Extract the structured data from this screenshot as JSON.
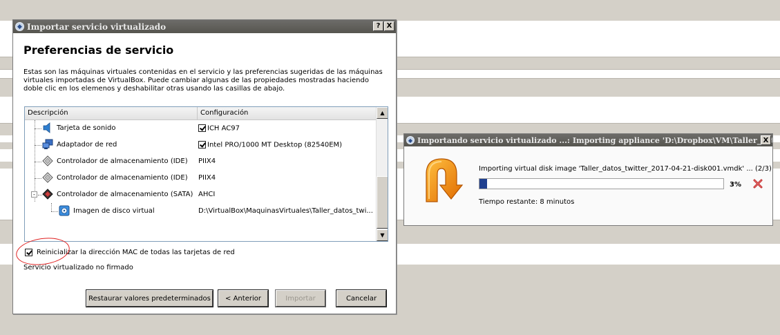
{
  "main_dialog": {
    "title": "Importar servicio virtualizado",
    "help_button": "?",
    "close_button": "X",
    "heading": "Preferencias de servicio",
    "description": "Estas son las máquinas virtuales contenidas en el servicio y las preferencias sugeridas de las máquinas virtuales importadas de VirtualBox. Puede cambiar algunas de las propiedades mostradas haciendo doble clic en los elemenos y deshabilitar otras usando las casillas de abajo.",
    "columns": {
      "description": "Descripción",
      "configuration": "Configuración"
    },
    "rows": [
      {
        "label": "Tarjeta de sonido",
        "config": "ICH AC97",
        "checked": true,
        "icon": "sound-card-icon"
      },
      {
        "label": "Adaptador de red",
        "config": "Intel PRO/1000 MT Desktop (82540EM)",
        "checked": true,
        "icon": "network-adapter-icon"
      },
      {
        "label": "Controlador de almacenamiento (IDE)",
        "config": "PIIX4",
        "icon": "ide-controller-icon"
      },
      {
        "label": "Controlador de almacenamiento (IDE)",
        "config": "PIIX4",
        "icon": "ide-controller-icon"
      },
      {
        "label": "Controlador de almacenamiento (SATA)",
        "config": "AHCI",
        "icon": "sata-controller-icon",
        "expander": "-"
      },
      {
        "label": "Imagen de disco virtual",
        "config": "D:\\VirtualBox\\MaquinasVirtuales\\Taller_datos_twi...",
        "icon": "virtual-disk-icon"
      }
    ],
    "mac_option": {
      "label": "Reinicializar la dirección MAC de todas las tarjetas de red",
      "checked": true
    },
    "unsigned_text": "Servicio virtualizado no firmado",
    "buttons": {
      "restore": "Restaurar valores predeterminados",
      "back": "< Anterior",
      "import": "Importar",
      "cancel": "Cancelar"
    }
  },
  "progress_dialog": {
    "title": "Importando servicio virtualizado ...: Importing appliance 'D:\\Dropbox\\VM\\Taller_dat...",
    "close_button": "X",
    "message": "Importing virtual disk image 'Taller_datos_twitter_2017-04-21-disk001.vmdk' ... (2/3)",
    "progress_percent": 3,
    "percent_label": "3%",
    "time_remaining": "Tiempo restante: 8 minutos"
  },
  "colors": {
    "titlebar": "#56554f",
    "progress_fill": "#1f3f8f",
    "annotation_circle": "#e02020",
    "arrow_orange": "#f08a00"
  }
}
